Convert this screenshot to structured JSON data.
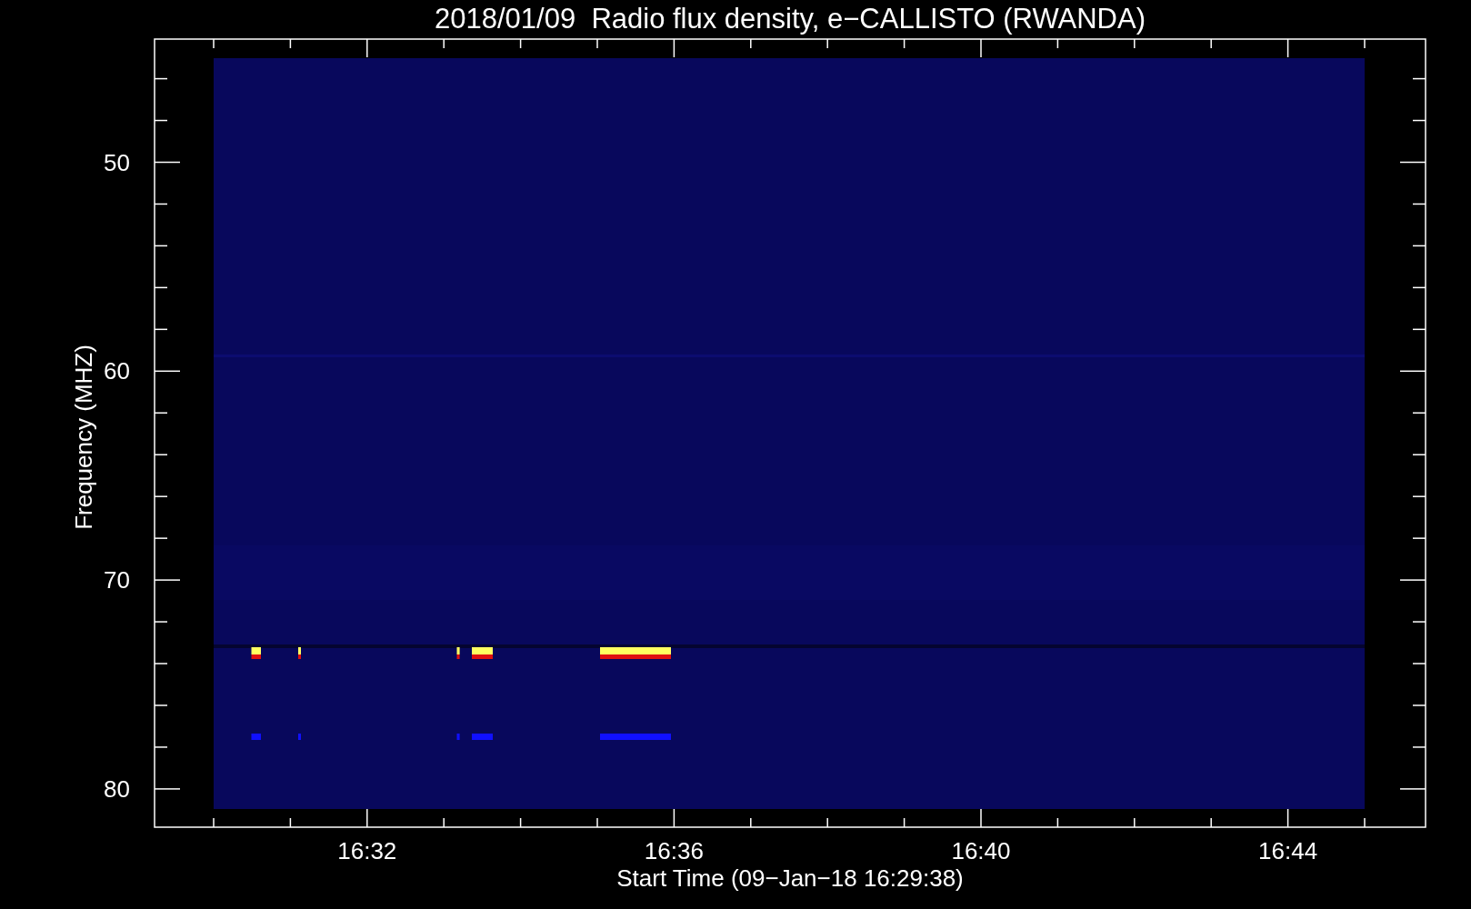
{
  "title": "2018/01/09  Radio flux density, e−CALLISTO (RWANDA)",
  "y_axis": {
    "label": "Frequency (MHZ)",
    "ticks": [
      "50",
      "60",
      "70",
      "80"
    ]
  },
  "x_axis": {
    "label": "Start Time (09−Jan−18 16:29:38)",
    "ticks": [
      "16:32",
      "16:36",
      "16:40",
      "16:44"
    ]
  }
}
